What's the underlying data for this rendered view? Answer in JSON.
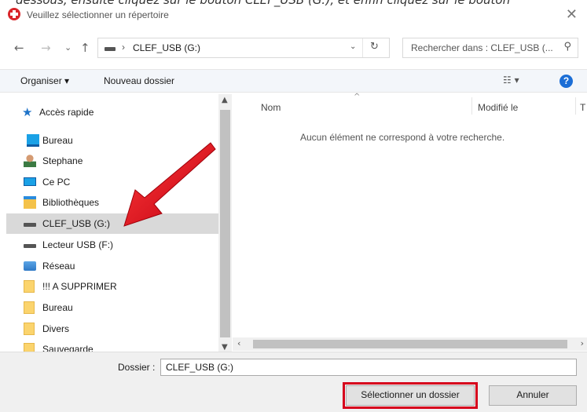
{
  "top_cut_text": "dessous, ensuite cliquez sur le bouton CLEF_USB (G:), et enfin cliquez sur le bouton",
  "window": {
    "title": "Veuillez sélectionner un répertoire",
    "close_glyph": "✕"
  },
  "nav": {
    "back": "←",
    "forward": "→",
    "recent": "⌄",
    "up": "↑",
    "address_sep": "›",
    "address_path": "CLEF_USB (G:)",
    "address_dropdown": "⌄",
    "refresh": "↻",
    "search_placeholder": "Rechercher dans : CLEF_USB (...",
    "search_icon": "⚲"
  },
  "cmdbar": {
    "organize": "Organiser ▾",
    "new_folder": "Nouveau dossier",
    "view_icon": "☷ ▾",
    "help": "?"
  },
  "sidebar": {
    "items": [
      {
        "label": "Accès rapide",
        "icon": "star-icon"
      },
      {
        "label": "Bureau",
        "icon": "desktop-icon"
      },
      {
        "label": "Stephane",
        "icon": "user-icon"
      },
      {
        "label": "Ce PC",
        "icon": "computer-icon"
      },
      {
        "label": "Bibliothèques",
        "icon": "library-icon"
      },
      {
        "label": "CLEF_USB (G:)",
        "icon": "usb-drive-icon",
        "selected": true
      },
      {
        "label": "Lecteur USB (F:)",
        "icon": "usb-drive-icon"
      },
      {
        "label": "Réseau",
        "icon": "network-icon"
      },
      {
        "label": "!!! A SUPPRIMER",
        "icon": "folder-icon"
      },
      {
        "label": "Bureau",
        "icon": "folder-icon"
      },
      {
        "label": "Divers",
        "icon": "folder-icon"
      },
      {
        "label": "Sauvegarde",
        "icon": "folder-icon"
      }
    ]
  },
  "content": {
    "col_name": "Nom",
    "col_modified": "Modifié le",
    "col_third": "T",
    "sort_caret": "^",
    "empty_message": "Aucun élément ne correspond à votre recherche."
  },
  "bottom": {
    "folder_label": "Dossier :",
    "folder_value": "CLEF_USB (G:)",
    "select_button": "Sélectionner un dossier",
    "cancel_button": "Annuler"
  },
  "colors": {
    "highlight_red": "#d6001c",
    "selection_bg": "#d9d9d9",
    "help_blue": "#1c6ed6"
  }
}
